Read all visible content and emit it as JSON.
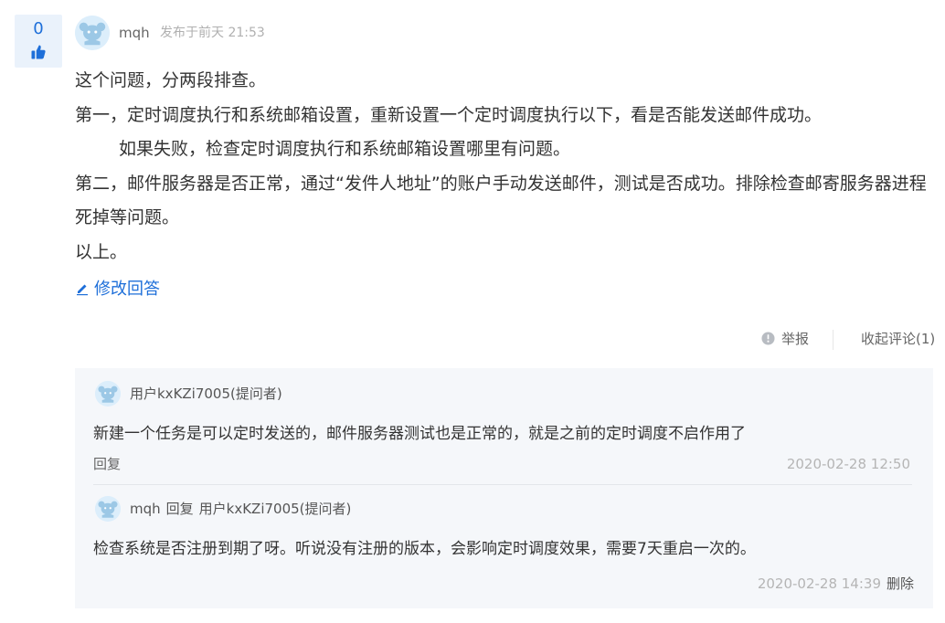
{
  "vote": {
    "count": "0",
    "icon": "thumbs-up-icon",
    "color": "#1e6fd9"
  },
  "post": {
    "author": "mqh",
    "time": "发布于前天 21:53",
    "lines": [
      "这个问题，分两段排查。",
      "第一，定时调度执行和系统邮箱设置，重新设置一个定时调度执行以下，看是否能发送邮件成功。",
      "如果失败，检查定时调度执行和系统邮箱设置哪里有问题。",
      "第二，邮件服务器是否正常，通过“发件人地址”的账户手动发送邮件，测试是否成功。排除检查邮寄服务器进程死掉等问题。",
      "以上。"
    ],
    "edit_label": "修改回答",
    "edit_icon": "pencil-icon"
  },
  "actions": {
    "report_label": "举报",
    "report_icon": "info-circle-icon",
    "collapse_label": "收起评论(1)"
  },
  "comments": [
    {
      "user": "用户kxKZi7005(提问者)",
      "text": "新建一个任务是可以定时发送的，邮件服务器测试也是正常的，就是之前的定时调度不启作用了",
      "reply_label": "回复",
      "time": "2020-02-28 12:50"
    },
    {
      "user": "mqh",
      "reply_word": "回复",
      "reply_to": "用户kxKZi7005(提问者)",
      "text": "检查系统是否注册到期了呀。听说没有注册的版本，会影响定时调度效果，需要7天重启一次的。",
      "time": "2020-02-28 14:39",
      "delete_label": "删除"
    }
  ]
}
